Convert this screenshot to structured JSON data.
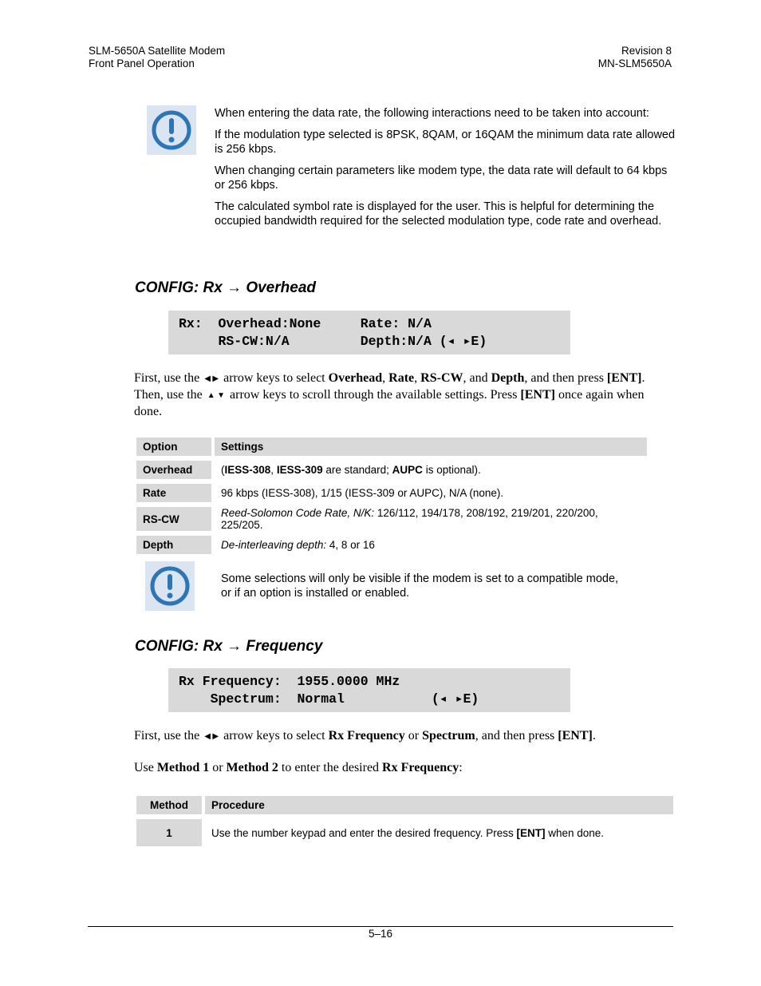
{
  "header": {
    "left_line1": "SLM-5650A Satellite Modem",
    "left_line2": "Front Panel Operation",
    "right_line1": "Revision 8",
    "right_line2": "MN-SLM5650A"
  },
  "note1": {
    "icon": "exclamation-circle-icon",
    "paragraphs": [
      "When entering the data rate, the following interactions need to be taken into account:",
      "If the modulation type selected is 8PSK, 8QAM,  or 16QAM the minimum data rate allowed is 256 kbps.",
      "When changing certain parameters like modem type, the data rate will default to 64 kbps or 256 kbps.",
      "The calculated symbol rate is displayed for the user. This is helpful for determining the occupied bandwidth required for the selected  modulation type, code rate and overhead."
    ]
  },
  "section_overhead": {
    "title": "CONFIG: Rx → Overhead",
    "lcd_line1": "Rx:  Overhead:None     Rate: N/A",
    "lcd_line2": "     RS-CW:N/A         Depth:N/A (◂ ▸E)",
    "instruction": {
      "t1": "First, use the ",
      "left_right_keys": "◀ ▶",
      "t2": " arrow keys to select ",
      "b1": "Overhead",
      "t3": ", ",
      "b2": "Rate",
      "t4": ", ",
      "b3": "RS-CW",
      "t5": ", and ",
      "b4": "Depth",
      "t6": ", and then press ",
      "b5": "[ENT]",
      "t7": ". Then, use the ",
      "up_down_keys": "▲ ▼",
      "t8": " arrow keys to scroll through the available settings. Press ",
      "b6": "[ENT]",
      "t9": " once again when done."
    },
    "table": {
      "headers": [
        "Option",
        "Settings"
      ],
      "rows": [
        {
          "option": "Overhead",
          "p1": "(",
          "b1": "IESS-308",
          "p2": ", ",
          "b2": "IESS-309",
          "p3": " are standard; ",
          "b3": "AUPC",
          "p4": " is optional)."
        },
        {
          "option": "Rate",
          "text": "96 kbps (IESS-308), 1/15 (IESS-309 or AUPC), N/A (none)."
        },
        {
          "option": "RS-CW",
          "italic": "Reed-Solomon Code Rate, N/K:",
          "text": " 126/112, 194/178,  208/192, 219/201, 220/200, 225/205."
        },
        {
          "option": "Depth",
          "italic": "De-interleaving depth:",
          "text": " 4, 8 or 16"
        }
      ]
    }
  },
  "note2": {
    "icon": "exclamation-circle-icon",
    "text": "Some selections will only be visible if the modem is set to a compatible mode, or if an option is installed or enabled."
  },
  "section_frequency": {
    "title": "CONFIG: Rx → Frequency",
    "lcd_line1": "Rx Frequency:  1955.0000 MHz",
    "lcd_line2": "    Spectrum:  Normal           (◂ ▸E)",
    "instruction1": {
      "t1": "First, use the ",
      "left_right_keys": "◀ ▶",
      "t2": " arrow keys to select ",
      "b1": "Rx Frequency",
      "t3": " or ",
      "b2": "Spectrum",
      "t4": ", and then press ",
      "b3": "[ENT]",
      "t5": "."
    },
    "instruction2": {
      "t1": "Use ",
      "b1": "Method 1",
      "t2": " or ",
      "b2": "Method 2",
      "t3": " to enter the desired ",
      "b3": "Rx Frequency",
      "t4": ":"
    },
    "table": {
      "headers": [
        "Method",
        "Procedure"
      ],
      "rows": [
        {
          "method": "1",
          "t1": "Use the number keypad and enter the desired frequency. Press ",
          "b1": "[ENT]",
          "t2": " when done."
        }
      ]
    }
  },
  "footer": {
    "page_number": "5–16"
  }
}
